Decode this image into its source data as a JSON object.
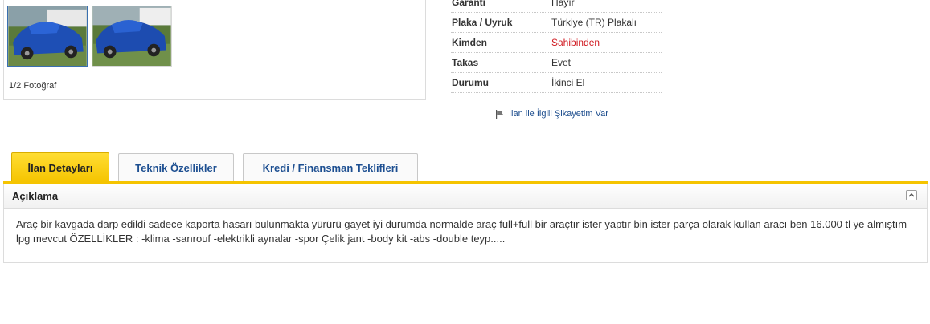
{
  "gallery": {
    "photo_count": "1/2 Fotoğraf"
  },
  "info": {
    "rows": [
      {
        "label": "Garanti",
        "value": "Hayır"
      },
      {
        "label": "Plaka / Uyruk",
        "value": "Türkiye (TR) Plakalı"
      },
      {
        "label": "Kimden",
        "value": "Sahibinden",
        "value_color": "#d0181f"
      },
      {
        "label": "Takas",
        "value": "Evet"
      },
      {
        "label": "Durumu",
        "value": "İkinci El"
      }
    ]
  },
  "complaint": {
    "label": "İlan ile İlgili Şikayetim Var",
    "icon": "flag-icon"
  },
  "tabs": [
    {
      "label": "İlan Detayları",
      "active": true
    },
    {
      "label": "Teknik Özellikler",
      "active": false
    },
    {
      "label": "Kredi / Finansman Teklifleri",
      "active": false
    }
  ],
  "description": {
    "title": "Açıklama",
    "collapse_icon": "chevron-up-icon",
    "text": "Araç bir kavgada darp edildi sadece kaporta hasarı bulunmakta yürürü gayet iyi durumda normalde araç full+full bir araçtır ister yaptır bin ister parça olarak kullan aracı ben 16.000 tl ye almıştım lpg mevcut ÖZELLİKLER : -klima -sanrouf -elektrikli aynalar -spor Çelik jant -body kit -abs -double teyp....."
  },
  "colors": {
    "accent": "#f5c400",
    "link": "#1d4f91",
    "highlight_red": "#d0181f"
  }
}
